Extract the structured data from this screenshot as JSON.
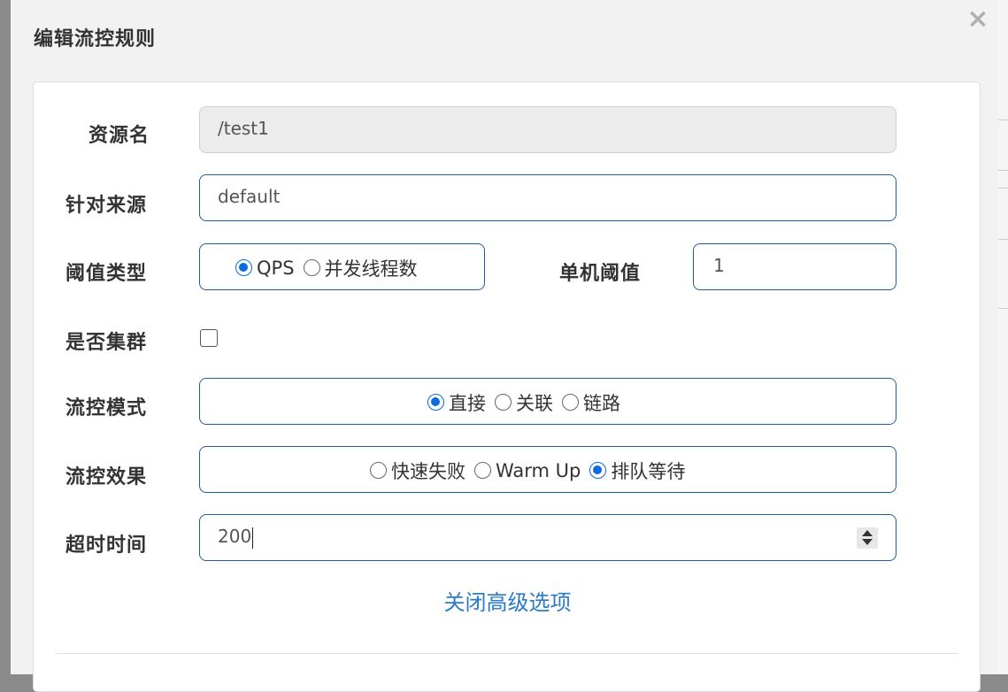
{
  "dialog": {
    "title": "编辑流控规则",
    "close_glyph": "×"
  },
  "form": {
    "resource": {
      "label": "资源名",
      "value": "/test1"
    },
    "limit_app": {
      "label": "针对来源",
      "value": "default"
    },
    "grade": {
      "label": "阈值类型",
      "options": [
        "QPS",
        "并发线程数"
      ],
      "selected": "QPS"
    },
    "count": {
      "label": "单机阈值",
      "value": "1"
    },
    "cluster": {
      "label": "是否集群",
      "checked": false
    },
    "strategy": {
      "label": "流控模式",
      "options": [
        "直接",
        "关联",
        "链路"
      ],
      "selected": "直接"
    },
    "control_behavior": {
      "label": "流控效果",
      "options": [
        "快速失败",
        "Warm Up",
        "排队等待"
      ],
      "selected": "排队等待"
    },
    "timeout": {
      "label": "超时时间",
      "value": "200"
    },
    "advanced_toggle": "关闭高级选项"
  },
  "colors": {
    "accent": "#0a6cde",
    "border": "#1f5e9e",
    "link": "#2a7cc7"
  }
}
